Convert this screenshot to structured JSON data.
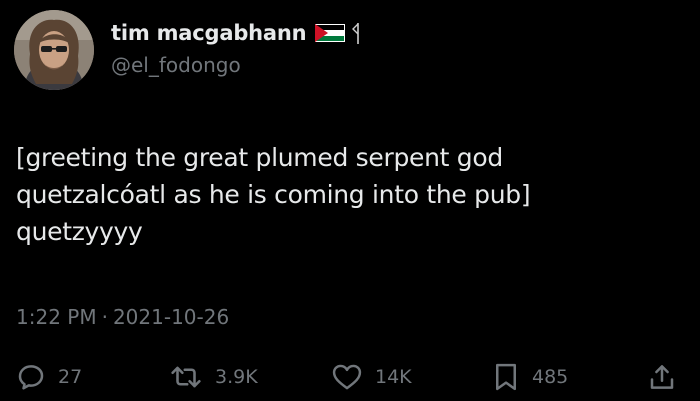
{
  "author": {
    "display_name": "tim macgabhann",
    "handle": "@el_fodongo",
    "flag_icon": "palestine-flag-icon",
    "extra_icon": "flagpole-icon"
  },
  "tweet": {
    "lines": [
      "[greeting the great plumed serpent god",
      "quetzalcóatl as he is coming into the pub]",
      "quetzyyyy"
    ]
  },
  "meta": {
    "time": "1:22 PM",
    "separator": "·",
    "date": "2021-10-26"
  },
  "actions": {
    "reply": {
      "icon": "reply-icon",
      "count": "27"
    },
    "retweet": {
      "icon": "retweet-icon",
      "count": "3.9K"
    },
    "like": {
      "icon": "heart-icon",
      "count": "14K"
    },
    "bookmark": {
      "icon": "bookmark-icon",
      "count": "485"
    },
    "share": {
      "icon": "share-icon"
    }
  },
  "colors": {
    "background": "#000000",
    "primary_text": "#e7e9ea",
    "secondary_text": "#71767b",
    "flag_red": "#ce1126",
    "flag_green": "#007a3d"
  }
}
